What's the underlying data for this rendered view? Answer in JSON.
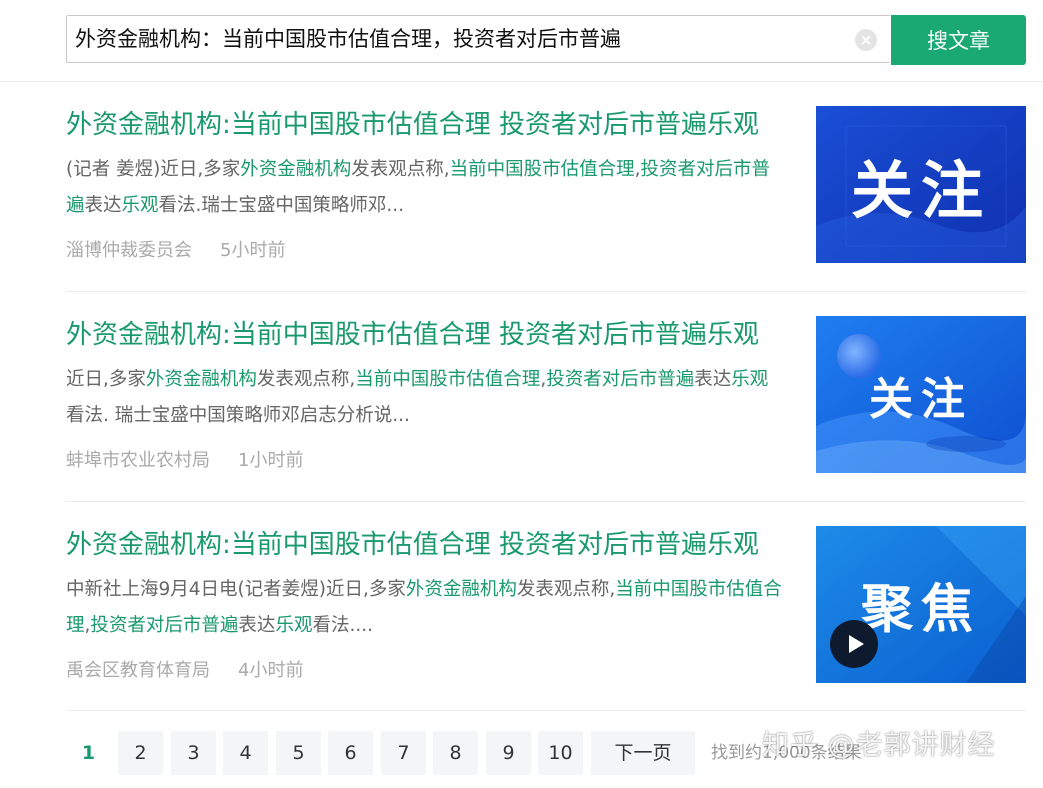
{
  "search": {
    "query": "外资金融机构：当前中国股市估值合理，投资者对后市普遍",
    "clear_icon": "×",
    "button_label": "搜文章"
  },
  "results": [
    {
      "title": "外资金融机构:当前中国股市估值合理 投资者对后市普遍乐观",
      "snippet": [
        {
          "t": "(记者 姜煜)近日,多家",
          "hl": false
        },
        {
          "t": "外资金融机构",
          "hl": true
        },
        {
          "t": "发表观点称,",
          "hl": false
        },
        {
          "t": "当前中国股市估值合理",
          "hl": true
        },
        {
          "t": ",",
          "hl": false
        },
        {
          "t": "投资者对后市普遍",
          "hl": true
        },
        {
          "t": "表达",
          "hl": false
        },
        {
          "t": "乐观",
          "hl": true
        },
        {
          "t": "看法.瑞士宝盛中国策略师邓...",
          "hl": false
        }
      ],
      "source": "淄博仲裁委员会",
      "time": "5小时前",
      "thumb_text": "关注"
    },
    {
      "title": "外资金融机构:当前中国股市估值合理 投资者对后市普遍乐观",
      "snippet": [
        {
          "t": "近日,多家",
          "hl": false
        },
        {
          "t": "外资金融机构",
          "hl": true
        },
        {
          "t": "发表观点称,",
          "hl": false
        },
        {
          "t": "当前中国股市估值合理",
          "hl": true
        },
        {
          "t": ",",
          "hl": false
        },
        {
          "t": "投资者对后市普遍",
          "hl": true
        },
        {
          "t": "表达",
          "hl": false
        },
        {
          "t": "乐观",
          "hl": true
        },
        {
          "t": "看法. 瑞士宝盛中国策略师邓启志分析说...",
          "hl": false
        }
      ],
      "source": "蚌埠市农业农村局",
      "time": "1小时前",
      "thumb_text": "关注"
    },
    {
      "title": "外资金融机构:当前中国股市估值合理 投资者对后市普遍乐观",
      "snippet": [
        {
          "t": "中新社上海9月4日电(记者姜煜)近日,多家",
          "hl": false
        },
        {
          "t": "外资金融机构",
          "hl": true
        },
        {
          "t": "发表观点称,",
          "hl": false
        },
        {
          "t": "当前中国股市估值合理",
          "hl": true
        },
        {
          "t": ",",
          "hl": false
        },
        {
          "t": "投资者对后市普遍",
          "hl": true
        },
        {
          "t": "表达",
          "hl": false
        },
        {
          "t": "乐观",
          "hl": true
        },
        {
          "t": "看法....",
          "hl": false
        }
      ],
      "source": "禹会区教育体育局",
      "time": "4小时前",
      "thumb_text": "聚焦"
    }
  ],
  "pagination": {
    "pages": [
      "1",
      "2",
      "3",
      "4",
      "5",
      "6",
      "7",
      "8",
      "9",
      "10"
    ],
    "current": "1",
    "next_label": "下一页",
    "result_count": "找到约1,000条结果"
  },
  "watermark": "知乎 @老郭讲财经",
  "colors": {
    "accent": "#1aa873",
    "link": "#1a9a6c",
    "thumb_blue": "#1846c8"
  }
}
